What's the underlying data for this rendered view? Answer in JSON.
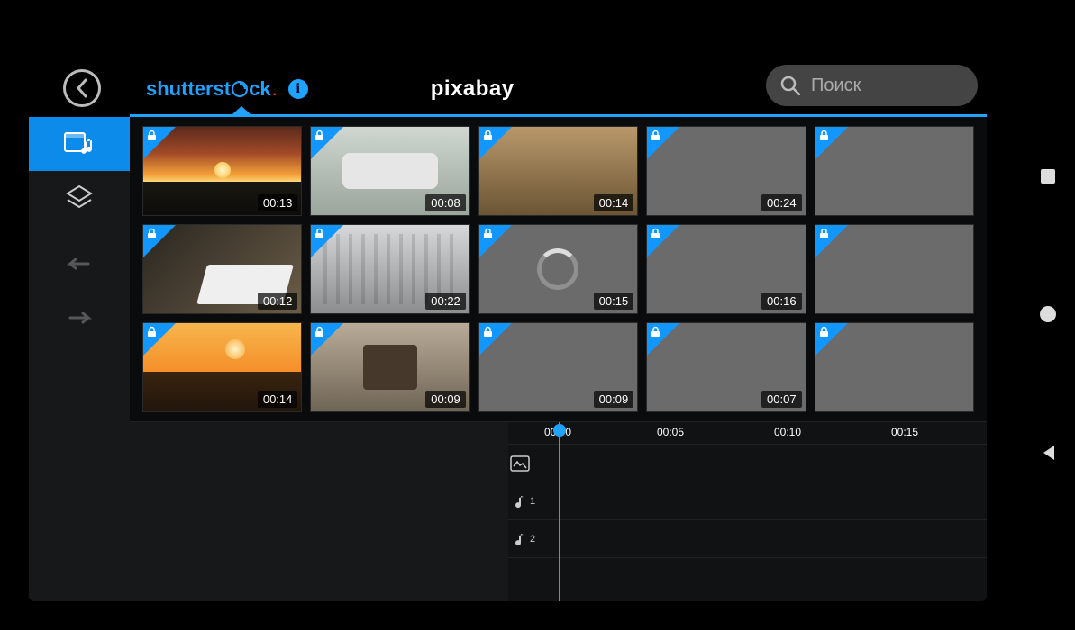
{
  "header": {
    "tab_shutter": "shutterst",
    "tab_shutter_suffix": "ck",
    "tab_pixabay": "pixabay",
    "search_placeholder": "Поиск"
  },
  "clips": [
    {
      "dur": "00:13",
      "cls": "sunset"
    },
    {
      "dur": "00:08",
      "cls": "factory"
    },
    {
      "dur": "00:14",
      "cls": "robots"
    },
    {
      "dur": "00:24",
      "cls": ""
    },
    {
      "dur": "",
      "cls": ""
    },
    {
      "dur": "00:12",
      "cls": "typing"
    },
    {
      "dur": "00:22",
      "cls": "lobby"
    },
    {
      "dur": "00:15",
      "cls": "",
      "loading": true
    },
    {
      "dur": "00:16",
      "cls": ""
    },
    {
      "dur": "",
      "cls": ""
    },
    {
      "dur": "00:14",
      "cls": "savanna"
    },
    {
      "dur": "00:09",
      "cls": "phone"
    },
    {
      "dur": "00:09",
      "cls": ""
    },
    {
      "dur": "00:07",
      "cls": ""
    },
    {
      "dur": "",
      "cls": ""
    }
  ],
  "timeline": {
    "t0": "00:00",
    "t1": "00:05",
    "t2": "00:10",
    "t3": "00:15",
    "audio1": "1",
    "audio2": "2"
  }
}
